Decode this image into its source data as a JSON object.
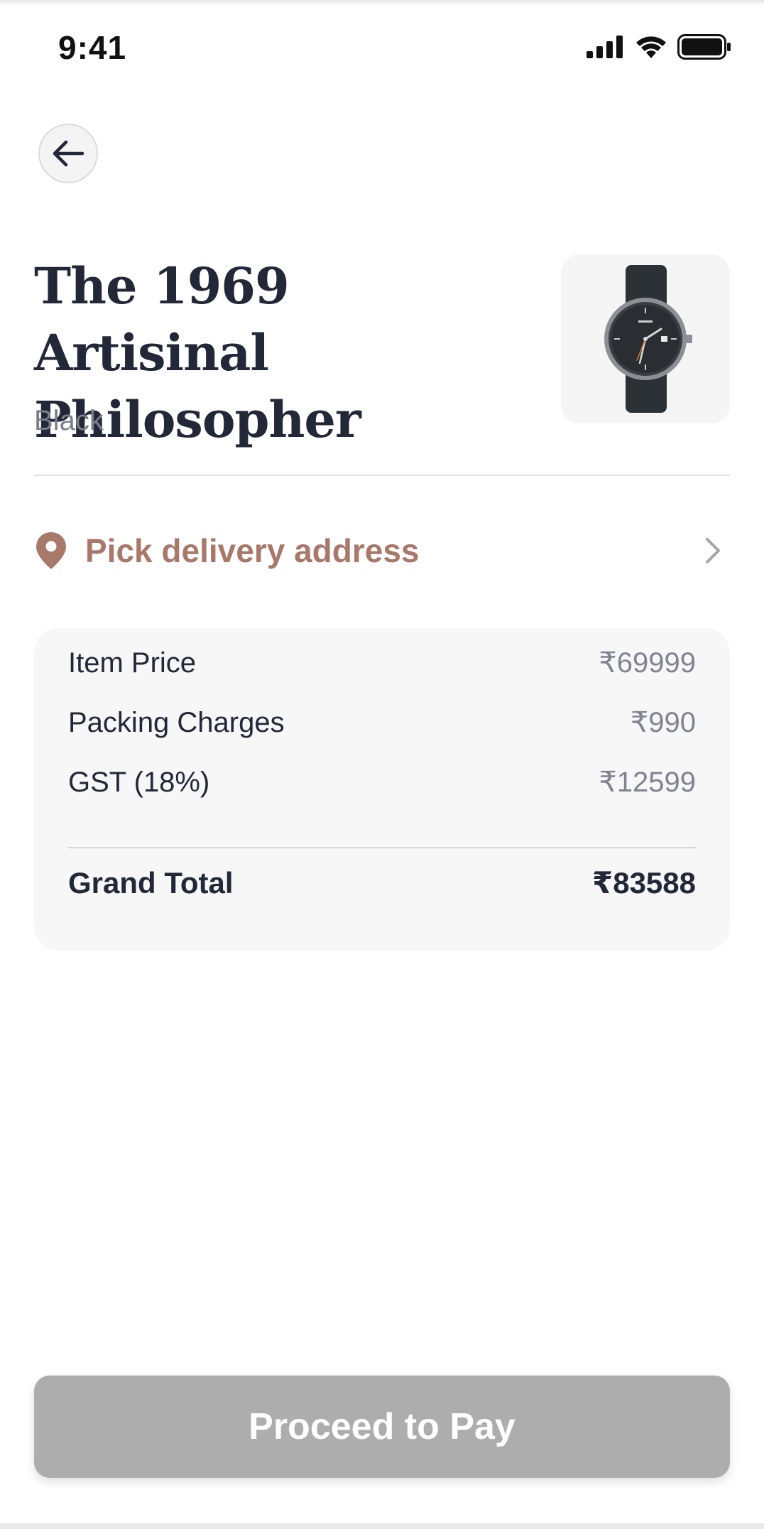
{
  "status_bar": {
    "time": "9:41",
    "icons": [
      "cellular-signal-icon",
      "wifi-icon",
      "battery-icon"
    ]
  },
  "navigation": {
    "back_icon": "arrow-left-icon"
  },
  "product": {
    "title": "The 1969 Artisinal Philosopher",
    "variant": "Black",
    "image_icon": "wristwatch-icon"
  },
  "delivery": {
    "label": "Pick delivery address",
    "icon": "location-pin-icon",
    "chevron": "chevron-right-icon"
  },
  "summary": {
    "rows": [
      {
        "label": "Item Price",
        "value": "₹69999"
      },
      {
        "label": "Packing Charges",
        "value": "₹990"
      },
      {
        "label": "GST (18%)",
        "value": "₹12599"
      }
    ],
    "total": {
      "label": "Grand Total",
      "value": "₹83588"
    }
  },
  "actions": {
    "pay_label": "Proceed to Pay"
  },
  "colors": {
    "title": "#232838",
    "accent": "#a8796a",
    "muted": "#7b7e88",
    "card_bg": "#f7f7f7",
    "button_disabled": "#adadad"
  }
}
